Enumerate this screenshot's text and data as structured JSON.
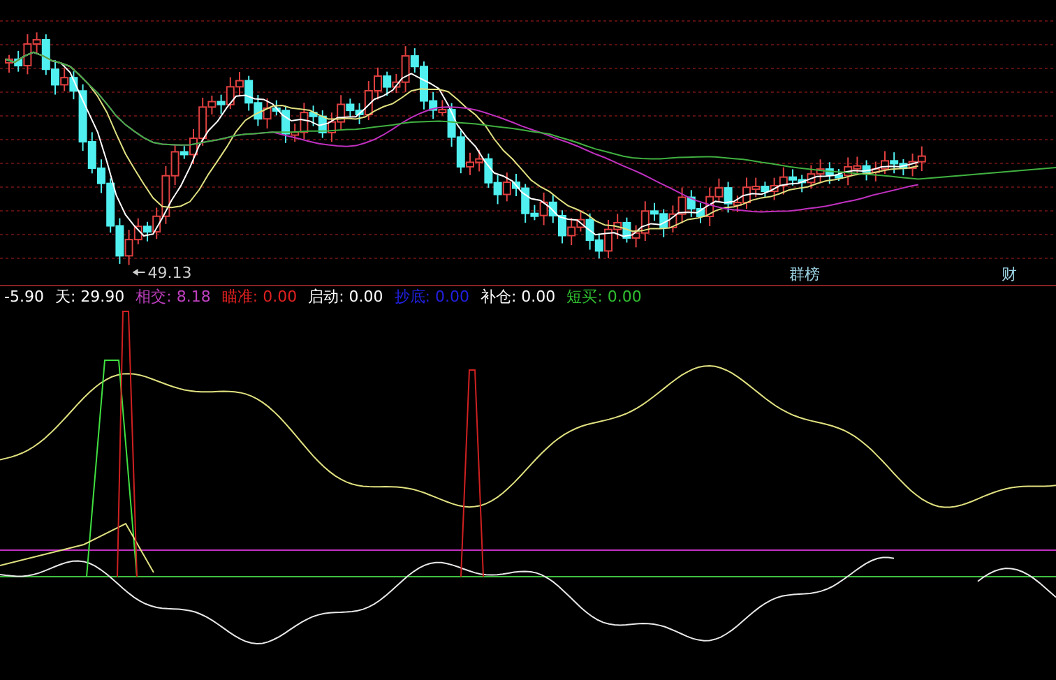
{
  "price_panel": {
    "low_marker": "49.13",
    "buttons": [
      {
        "label": "群榜"
      },
      {
        "label": "财"
      }
    ]
  },
  "indicator_bar": {
    "items": [
      {
        "text": "-5.90",
        "color": "#ffffff"
      },
      {
        "text": "天: 29.90",
        "color": "#ffffff"
      },
      {
        "text": "相交: 8.18",
        "color": "#c040c0"
      },
      {
        "text": "瞄准: 0.00",
        "color": "#e02020"
      },
      {
        "text": "启动: 0.00",
        "color": "#ffffff"
      },
      {
        "text": "抄底: 0.00",
        "color": "#2020e0"
      },
      {
        "text": "补仓: 0.00",
        "color": "#ffffff"
      },
      {
        "text": "短买: 0.00",
        "color": "#30c030"
      }
    ]
  }
}
